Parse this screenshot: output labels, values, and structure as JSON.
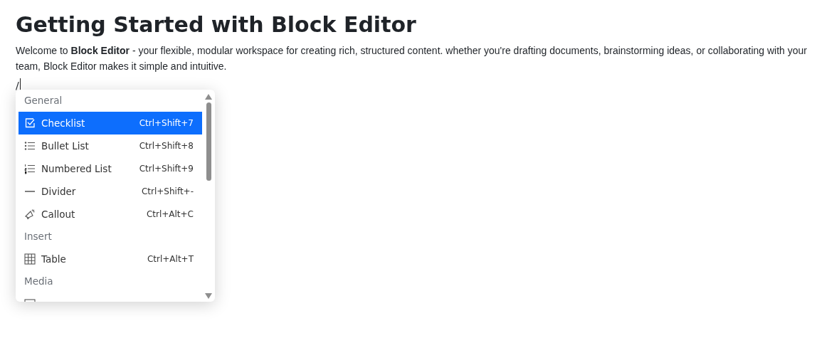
{
  "title": "Getting Started with Block Editor",
  "intro": "Welcome to **Block Editor** - your flexible, modular workspace for creating rich, structured content. whether you're drafting documents, brainstorming ideas, or collaborating with your team, Block Editor makes it simple and intuitive.",
  "command_input": "/",
  "menu": {
    "groups": [
      {
        "label": "General",
        "items": [
          {
            "kind": "checkbox",
            "label": "Checklist",
            "shortcut": "Ctrl+Shift+7",
            "selected": true
          },
          {
            "kind": "bullets",
            "label": "Bullet List",
            "shortcut": "Ctrl+Shift+8",
            "selected": false
          },
          {
            "kind": "numbers",
            "label": "Numbered List",
            "shortcut": "Ctrl+Shift+9",
            "selected": false
          },
          {
            "kind": "dash",
            "label": "Divider",
            "shortcut": "Ctrl+Shift+-",
            "selected": false
          },
          {
            "kind": "megaphone",
            "label": "Callout",
            "shortcut": "Ctrl+Alt+C",
            "selected": false
          }
        ]
      },
      {
        "label": "Insert",
        "items": [
          {
            "kind": "grid",
            "label": "Table",
            "shortcut": "Ctrl+Alt+T",
            "selected": false
          }
        ]
      },
      {
        "label": "Media",
        "items": [
          {
            "kind": "image",
            "selected": false
          }
        ]
      }
    ]
  }
}
